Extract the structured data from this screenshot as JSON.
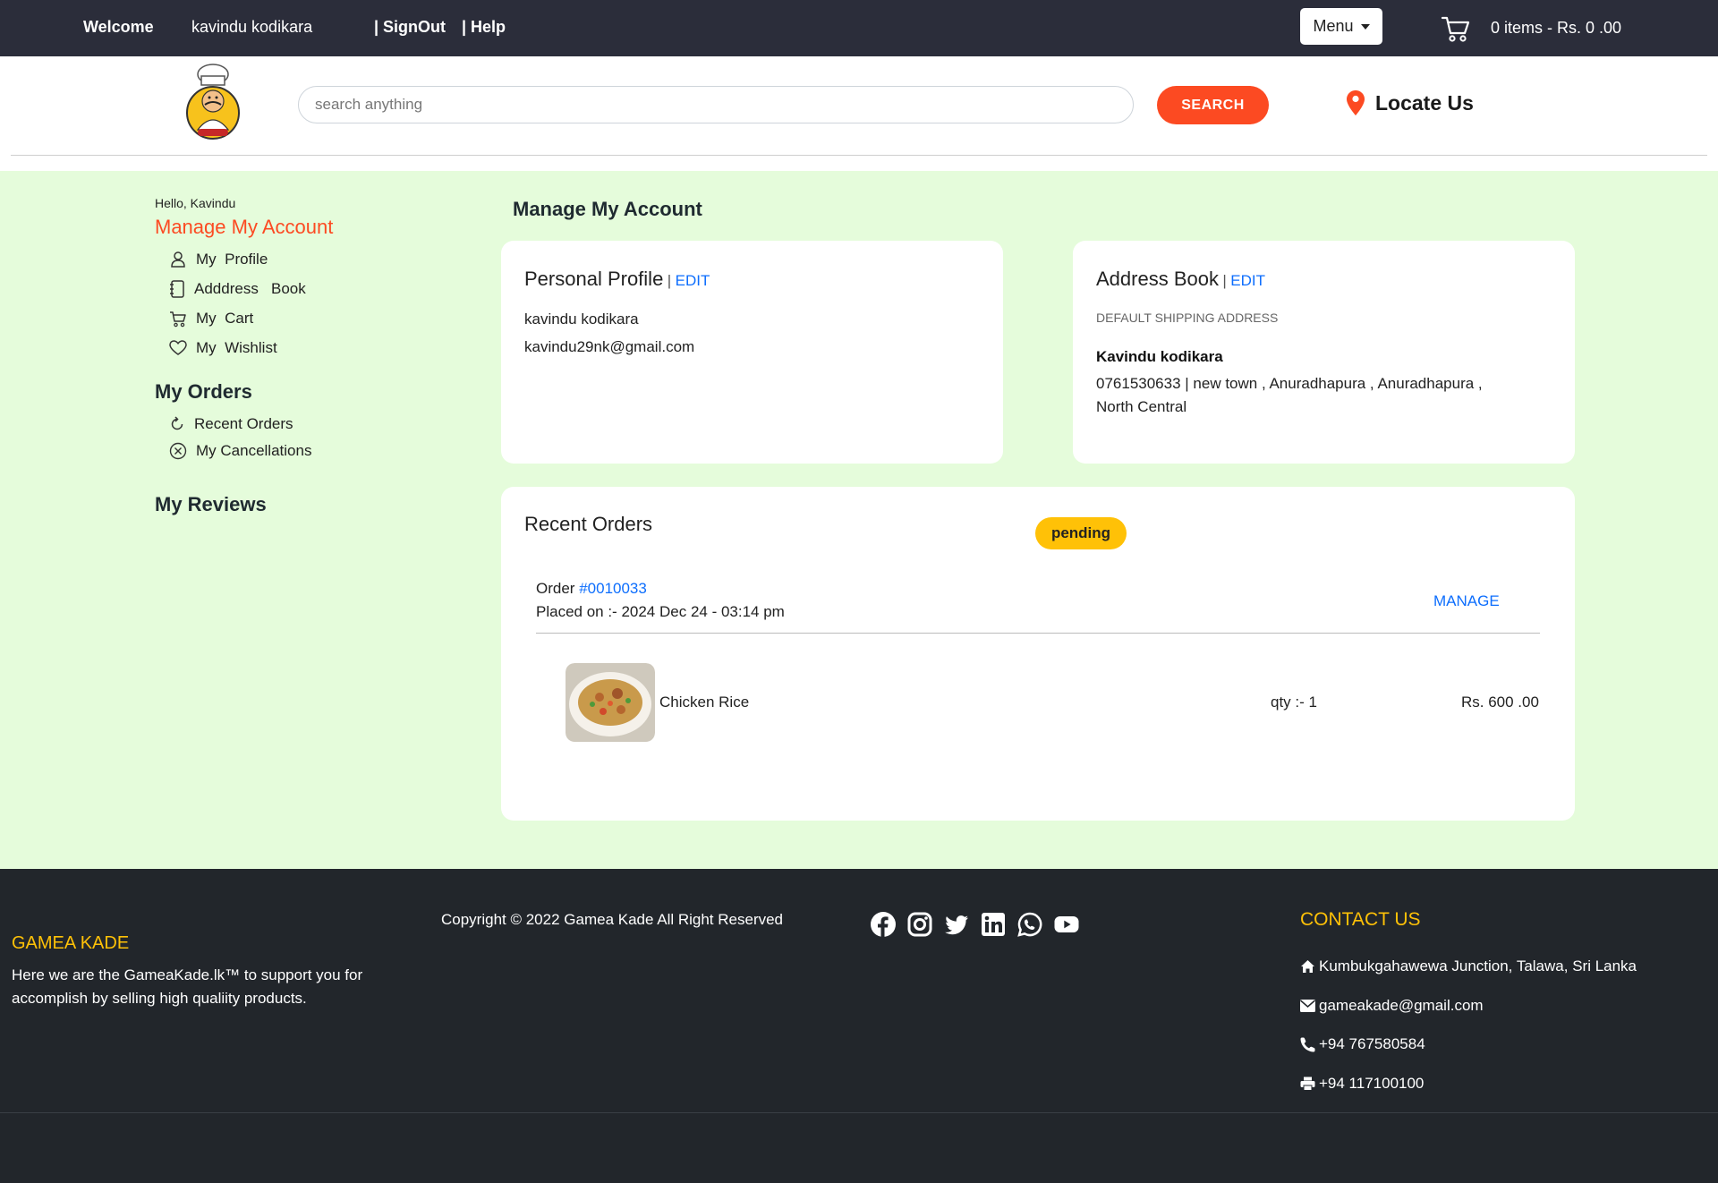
{
  "topbar": {
    "welcome": "Welcome",
    "username": "kavindu kodikara",
    "signout": "| SignOut",
    "help": "| Help",
    "menu_label": "Menu",
    "cart_text": "0 items - Rs. 0 .00"
  },
  "header": {
    "search_placeholder": "search anything",
    "search_button": "SEARCH",
    "locate_label": "Locate Us",
    "accent_color": "#fc4a22"
  },
  "sidebar": {
    "hello": "Hello, Kavindu",
    "manage_account": "Manage My Account",
    "account_items": [
      {
        "label": "My  Profile",
        "icon": "person-icon"
      },
      {
        "label": "Adddress   Book",
        "icon": "notebook-icon"
      },
      {
        "label": "My  Cart",
        "icon": "cart-icon"
      },
      {
        "label": "My  Wishlist",
        "icon": "heart-icon"
      }
    ],
    "orders_heading": "My Orders",
    "order_items": [
      {
        "label": "Recent Orders",
        "icon": "refresh-icon"
      },
      {
        "label": "My Cancellations",
        "icon": "cancel-circle-icon"
      }
    ],
    "reviews_heading": "My Reviews"
  },
  "main": {
    "title": "Manage My Account",
    "profile": {
      "title": "Personal Profile",
      "edit": "EDIT",
      "name": "kavindu kodikara",
      "email": "kavindu29nk@gmail.com"
    },
    "address": {
      "title": "Address Book",
      "edit": "EDIT",
      "label": "DEFAULT SHIPPING ADDRESS",
      "name": "Kavindu kodikara",
      "line1": "0761530633 | new town , Anuradhapura , Anuradhapura ,",
      "line2": "North Central"
    },
    "recent": {
      "title": "Recent Orders",
      "order_prefix": "Order",
      "order_id": "#0010033",
      "placed_on": "Placed on :- 2024 Dec 24 - 03:14 pm",
      "manage": "MANAGE",
      "item_name": "Chicken Rice",
      "status": "pending",
      "qty": "qty :- 1",
      "price": "Rs. 600 .00"
    }
  },
  "footer": {
    "brand": "GAMEA KADE",
    "description": "Here we are the GameaKade.lk™ to support you for accomplish by selling high qualiity products.",
    "copyright": "Copyright © 2022 Gamea Kade All Right Reserved",
    "social_icons": [
      "facebook-icon",
      "instagram-icon",
      "twitter-icon",
      "linkedin-icon",
      "whatsapp-icon",
      "youtube-icon"
    ],
    "contact_heading": "CONTACT US",
    "address": "Kumbukgahawewa Junction, Talawa, Sri Lanka",
    "email": "gameakade@gmail.com",
    "phone": "+94 767580584",
    "fax": "+94 117100100",
    "highlight_color": "#ffc107"
  }
}
